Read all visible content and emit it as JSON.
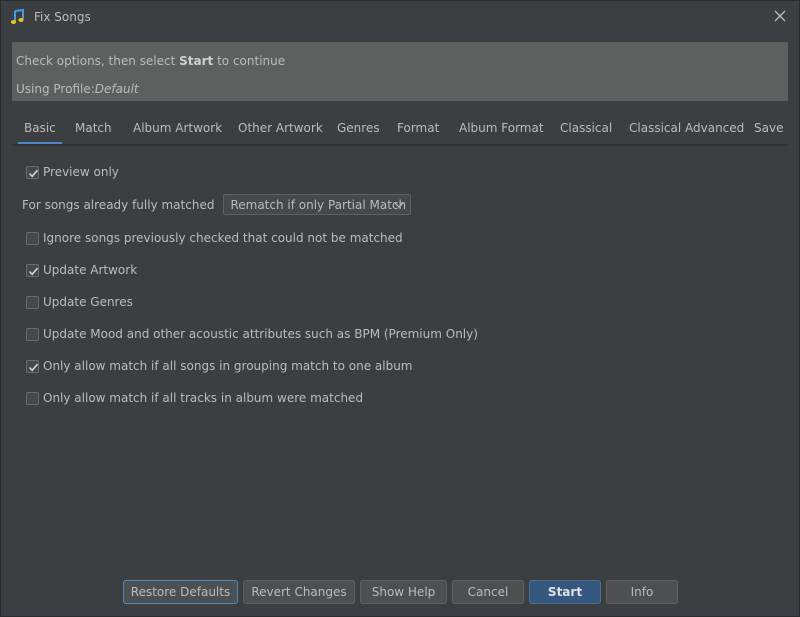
{
  "window": {
    "title": "Fix Songs",
    "icon": "music-note-icon"
  },
  "banner": {
    "line1_prefix": "Check options, then select ",
    "line1_bold": "Start",
    "line1_suffix": " to continue",
    "line2_prefix": "Using Profile:",
    "line2_profile": "Default"
  },
  "tabs": [
    {
      "label": "Basic",
      "active": true
    },
    {
      "label": "Match"
    },
    {
      "label": "Album Artwork"
    },
    {
      "label": "Other Artwork"
    },
    {
      "label": "Genres"
    },
    {
      "label": "Format"
    },
    {
      "label": "Album Format"
    },
    {
      "label": "Classical"
    },
    {
      "label": "Classical Advanced"
    },
    {
      "label": "Save"
    }
  ],
  "options": {
    "preview_only": {
      "label": "Preview only",
      "checked": true
    },
    "fully_matched": {
      "label": "For songs already fully matched",
      "value": "Rematch if only Partial Match"
    },
    "ignore_previously": {
      "label": "Ignore songs previously checked that could not be matched",
      "checked": false
    },
    "update_artwork": {
      "label": "Update Artwork",
      "checked": true
    },
    "update_genres": {
      "label": "Update Genres",
      "checked": false
    },
    "update_mood": {
      "label": "Update Mood and other acoustic attributes such as BPM (Premium Only)",
      "checked": false
    },
    "only_grouping": {
      "label": "Only allow match if all songs in grouping match to one album",
      "checked": true
    },
    "only_all_tracks": {
      "label": "Only allow match if all tracks in album were matched",
      "checked": false
    }
  },
  "buttons": {
    "restore_defaults": "Restore Defaults",
    "revert_changes": "Revert Changes",
    "show_help": "Show Help",
    "cancel": "Cancel",
    "start": "Start",
    "info": "Info"
  },
  "colors": {
    "background": "#3c3f41",
    "banner": "#5e6060",
    "accent": "#4a88c7",
    "primary_button": "#365880",
    "icon_blue": "#3ca0e8",
    "icon_yellow": "#f0c020"
  }
}
